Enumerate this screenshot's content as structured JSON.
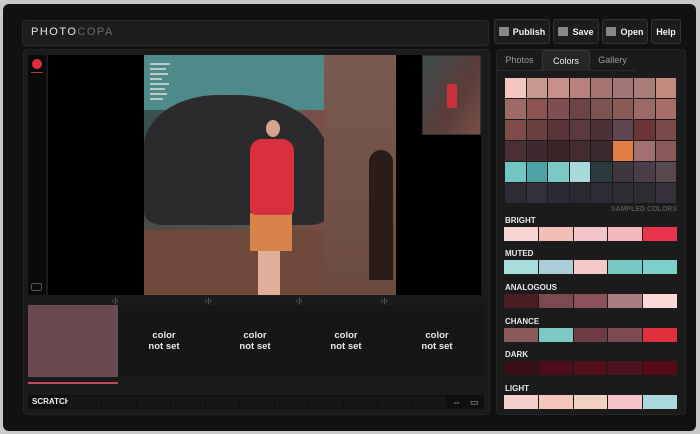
{
  "app": {
    "logo_main": "PHOTO",
    "logo_dim": "COPA"
  },
  "toolbar": {
    "publish": "Publish",
    "save": "Save",
    "open": "Open",
    "help": "Help"
  },
  "canvas_nav": {
    "left": "‹|›",
    "mid1": "‹|›",
    "mid2": "‹|›",
    "right": "‹|›"
  },
  "swatches": [
    {
      "color": "#6b4a4f",
      "label_line1": "",
      "label_line2": ""
    },
    {
      "color": "#161616",
      "label_line1": "color",
      "label_line2": "not set"
    },
    {
      "color": "#161616",
      "label_line1": "color",
      "label_line2": "not set"
    },
    {
      "color": "#161616",
      "label_line1": "color",
      "label_line2": "not set"
    },
    {
      "color": "#161616",
      "label_line1": "color",
      "label_line2": "not set"
    }
  ],
  "scratch": {
    "label": "SCRATCH"
  },
  "tabs": [
    "Photos",
    "Colors",
    "Gallery"
  ],
  "active_tab": "Colors",
  "sampled_label": "SAMPLED COLORS",
  "grid_colors": [
    "#f3c7c0",
    "#c79a90",
    "#c98f88",
    "#b9817b",
    "#a6736f",
    "#a37676",
    "#a77d77",
    "#c08a7e",
    "#9e6a65",
    "#8b5450",
    "#7e4e50",
    "#6d4446",
    "#7b5351",
    "#8a5a55",
    "#9a6a67",
    "#a66e66",
    "#7c4c49",
    "#6a3f40",
    "#5a3438",
    "#5b3a3e",
    "#4c3236",
    "#5e4750",
    "#6c3535",
    "#7a4a4a",
    "#4a3034",
    "#3e2a2e",
    "#3a2428",
    "#452c30",
    "#3b2a2e",
    "#e08048",
    "#a37070",
    "#8a5a58",
    "#6fc6c2",
    "#4ea4a4",
    "#7ac9c6",
    "#a7d8dc",
    "#2a3a3e",
    "#3f3640",
    "#4a3c48",
    "#5a4850",
    "#2e2a33",
    "#2f3038",
    "#2a2a35",
    "#2c2832",
    "#2b2b34",
    "#302c36",
    "#2d2a32",
    "#36303a"
  ],
  "palettes": [
    {
      "name": "BRIGHT",
      "colors": [
        "#f8d4d2",
        "#f0c0b8",
        "#f3c5c8",
        "#f2b8be",
        "#e8344c"
      ]
    },
    {
      "name": "MUTED",
      "colors": [
        "#a9dede",
        "#aacfd8",
        "#f6c9c9",
        "#78c9c4",
        "#7dd0c8"
      ]
    },
    {
      "name": "ANALOGOUS",
      "colors": [
        "#4a1c24",
        "#7a4a4e",
        "#8c5058",
        "#a87c80",
        "#fbd7d6"
      ]
    },
    {
      "name": "CHANCE",
      "colors": [
        "#8a5a5a",
        "#7cc8c4",
        "#6e3c44",
        "#7e4a52",
        "#e0303e"
      ]
    },
    {
      "name": "DARK",
      "colors": [
        "#3a1018",
        "#4a0e1a",
        "#50101a",
        "#4a1420",
        "#560c18"
      ]
    },
    {
      "name": "LIGHT",
      "colors": [
        "#f6d0cc",
        "#f6c8bc",
        "#f0d2c2",
        "#f4c4c8",
        "#aad8dc"
      ]
    }
  ]
}
